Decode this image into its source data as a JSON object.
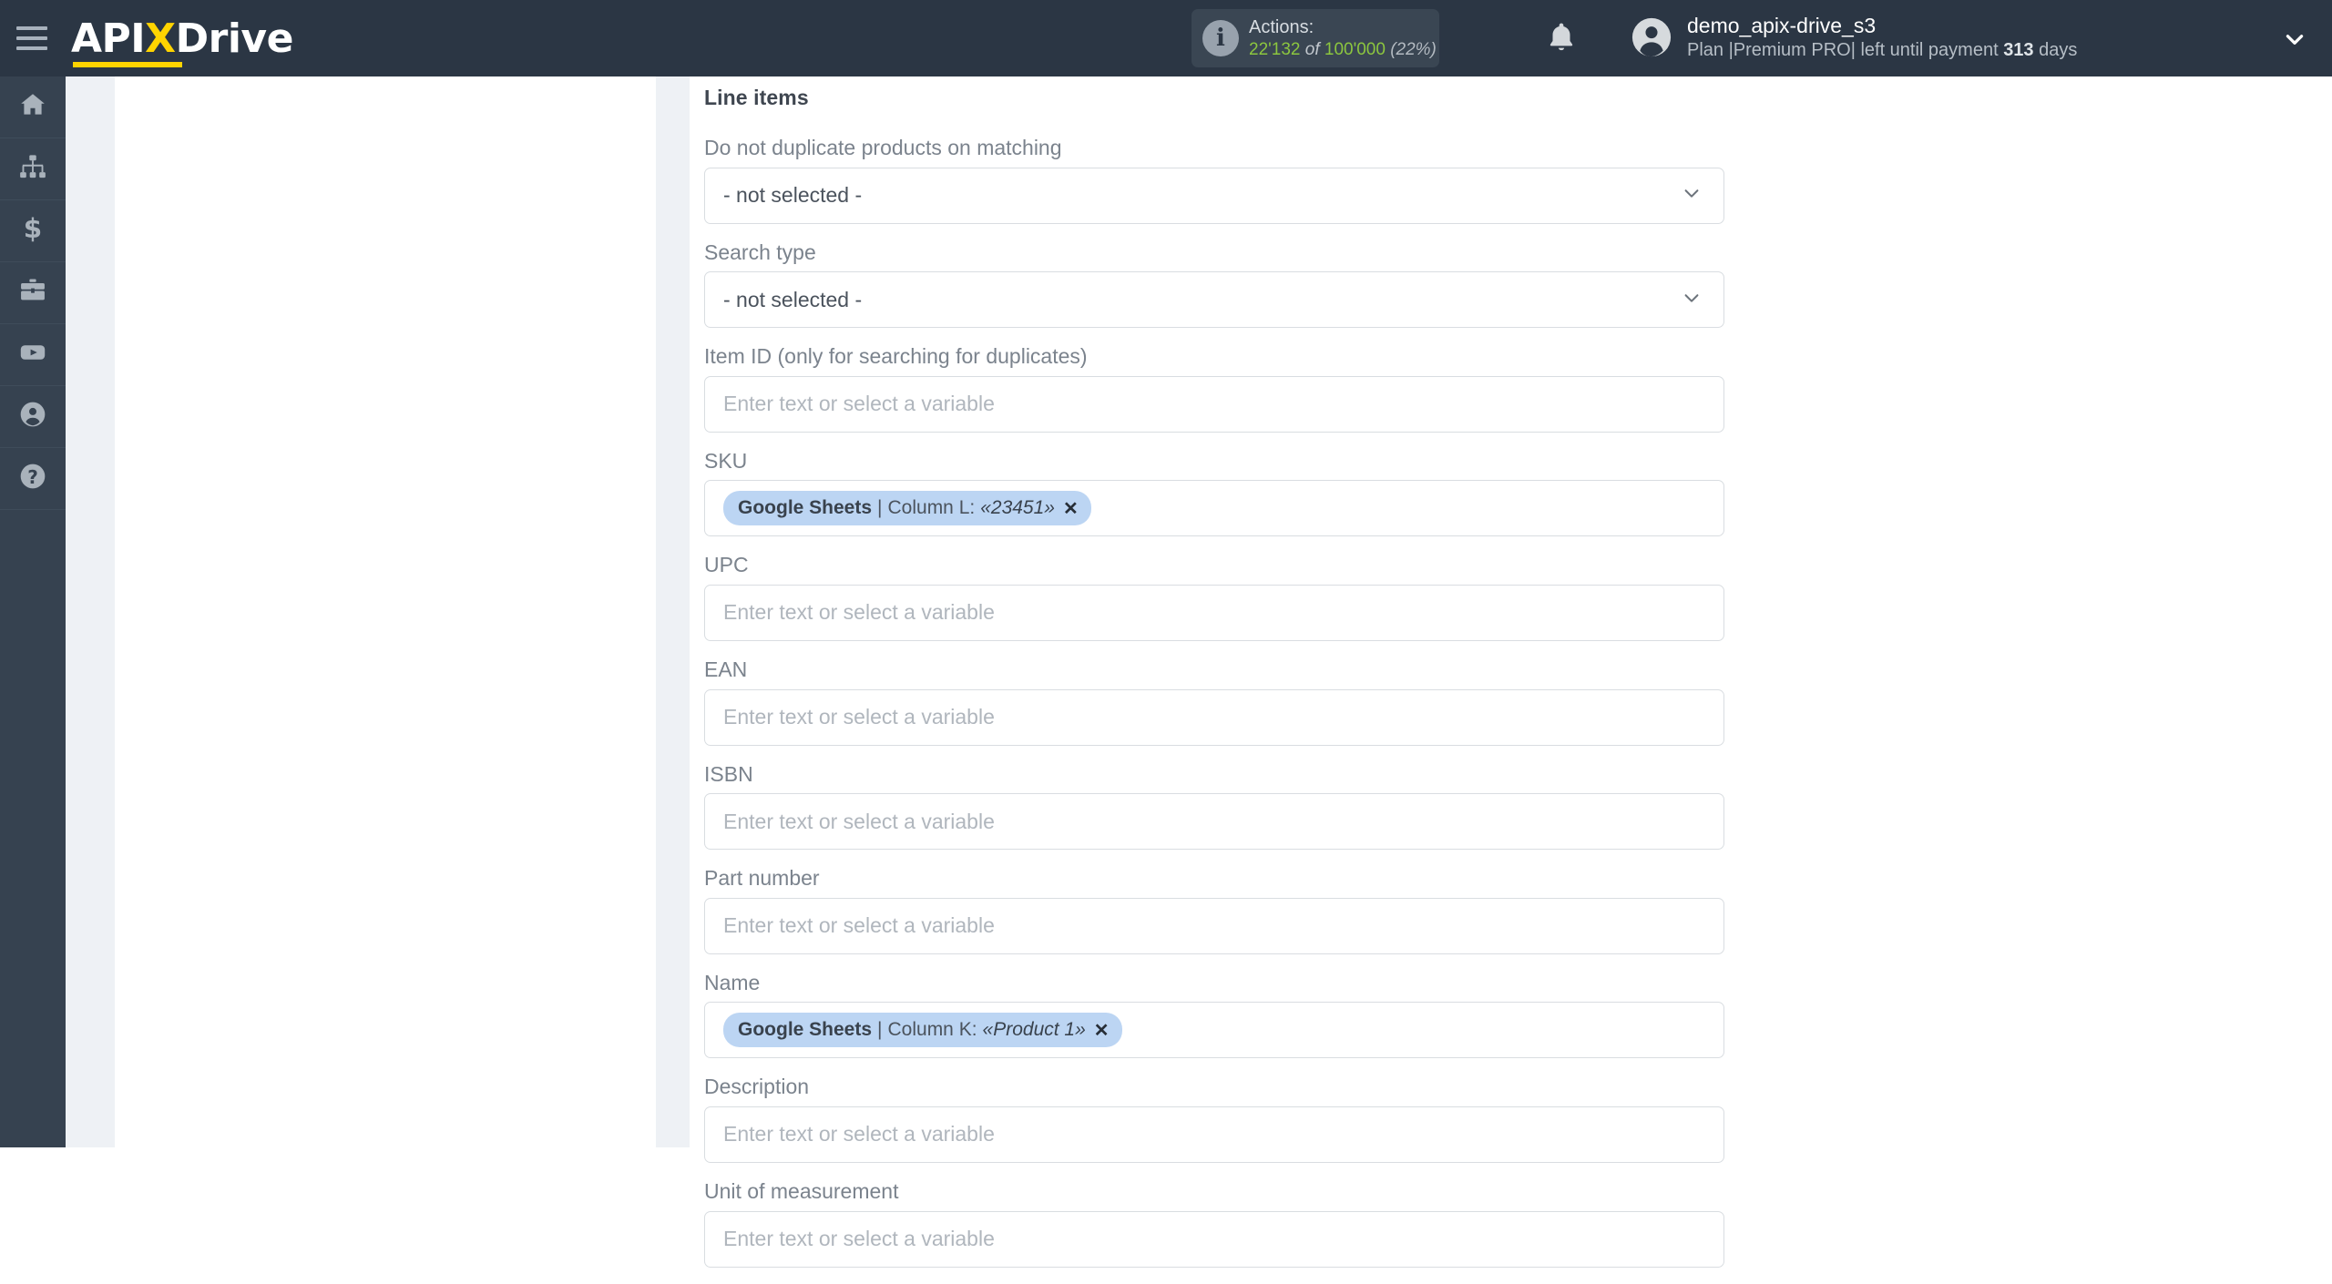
{
  "header": {
    "menu_icon": "hamburger-menu-icon",
    "logo": {
      "part1": "API",
      "accent": "X",
      "part2": "Drive"
    },
    "actions": {
      "icon": "info-icon",
      "label": "Actions:",
      "used": "22'132",
      "of": "of",
      "total": "100'000",
      "percent": "(22%)"
    },
    "notifications_icon": "bell-icon",
    "account": {
      "avatar_icon": "user-avatar-icon",
      "name": "demo_apix-drive_s3",
      "plan_prefix": "Plan |Premium PRO| left until payment ",
      "days_value": "313",
      "plan_suffix": " days",
      "dropdown_icon": "chevron-down-icon"
    },
    "colors": {
      "bar": "#2b3644",
      "accent": "#ffd400",
      "usage": "#8cc63f"
    }
  },
  "sidebar": {
    "items": [
      {
        "icon": "home-icon",
        "name": "sidebar-item-home"
      },
      {
        "icon": "connections-icon",
        "name": "sidebar-item-connections"
      },
      {
        "icon": "dollar-icon",
        "name": "sidebar-item-billing"
      },
      {
        "icon": "briefcase-icon",
        "name": "sidebar-item-business"
      },
      {
        "icon": "youtube-icon",
        "name": "sidebar-item-video"
      },
      {
        "icon": "user-circle-icon",
        "name": "sidebar-item-profile"
      },
      {
        "icon": "question-mark-icon",
        "name": "sidebar-item-help"
      }
    ]
  },
  "form": {
    "section_title": "Line items",
    "placeholder": "Enter text or select a variable",
    "not_selected": "- not selected -",
    "fields": [
      {
        "label": "Do not duplicate products on matching",
        "type": "select",
        "value": "- not selected -"
      },
      {
        "label": "Search type",
        "type": "select",
        "value": "- not selected -"
      },
      {
        "label": "Item ID (only for searching for duplicates)",
        "type": "text",
        "value": ""
      },
      {
        "label": "SKU",
        "type": "chip",
        "chip": {
          "source": "Google Sheets",
          "separator": "|",
          "column": "Column L:",
          "value": "«23451»",
          "remove": "✕"
        }
      },
      {
        "label": "UPC",
        "type": "text",
        "value": ""
      },
      {
        "label": "EAN",
        "type": "text",
        "value": ""
      },
      {
        "label": "ISBN",
        "type": "text",
        "value": ""
      },
      {
        "label": "Part number",
        "type": "text",
        "value": ""
      },
      {
        "label": "Name",
        "type": "chip",
        "chip": {
          "source": "Google Sheets",
          "separator": "|",
          "column": "Column K:",
          "value": "«Product 1»",
          "remove": "✕"
        }
      },
      {
        "label": "Description",
        "type": "text",
        "value": ""
      },
      {
        "label": "Unit of measurement",
        "type": "text",
        "value": ""
      }
    ]
  }
}
